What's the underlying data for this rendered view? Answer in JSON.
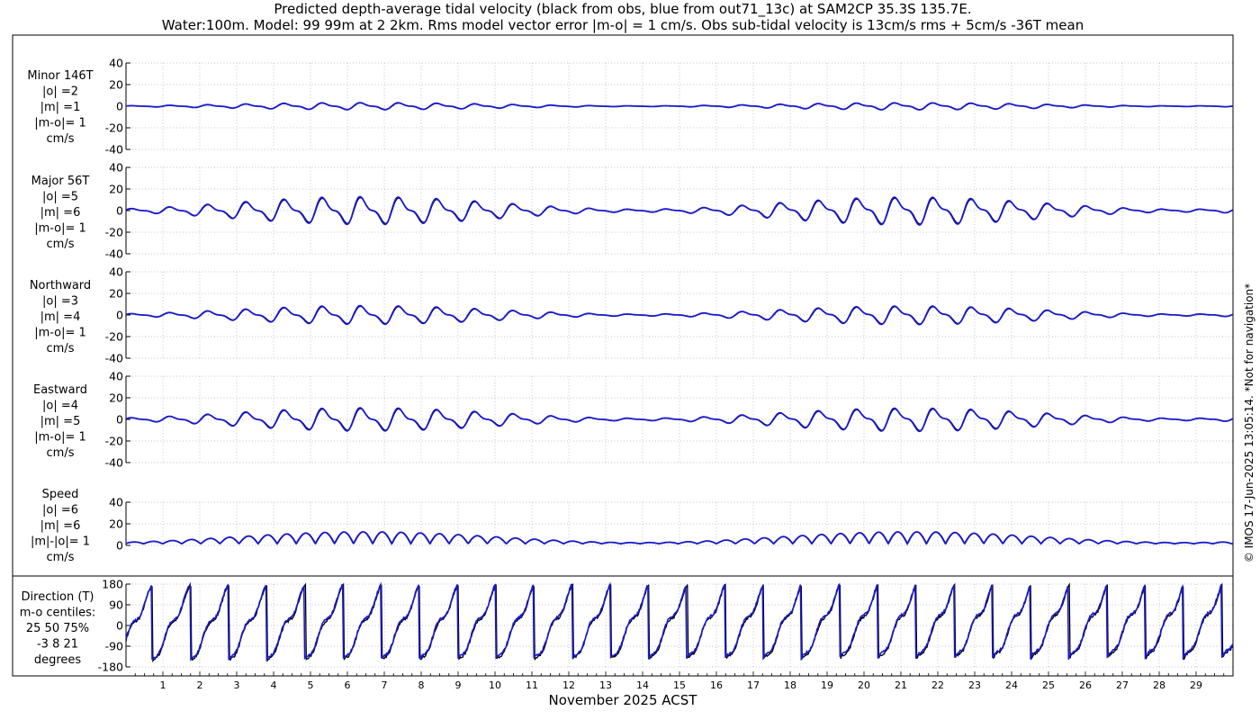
{
  "chart_data": {
    "type": "line",
    "title_line1": "Predicted depth-average tidal velocity (black from obs, blue from out71_13c) at SAM2CP 35.3S 135.7E.",
    "title_line2": "Water:100m. Model: 99 99m at 2 2km. Rms model vector error |m-o| = 1 cm/s. Obs sub-tidal velocity is 13cm/s rms + 5cm/s -36T mean",
    "xlabel": "November 2025 ACST",
    "x_tick_labels": [
      "1",
      "2",
      "3",
      "4",
      "5",
      "6",
      "7",
      "8",
      "9",
      "10",
      "11",
      "12",
      "13",
      "14",
      "15",
      "16",
      "17",
      "18",
      "19",
      "20",
      "21",
      "22",
      "23",
      "24",
      "25",
      "26",
      "27",
      "28",
      "29"
    ],
    "x_range_days": [
      0,
      30
    ],
    "copyright": "© IMOS 17-Jun-2025 13:05:14. *Not for navigation*",
    "series_colors": {
      "obs": "#000000",
      "model": "#1a1acc"
    },
    "grid": true,
    "panels": [
      {
        "id": "minor",
        "label_lines": [
          "Minor 146T",
          "|o| =2",
          "|m| =1",
          "|m-o|= 1",
          "cm/s"
        ],
        "ylim": [
          -40,
          40
        ],
        "yticks": [
          -40,
          -20,
          0,
          20,
          40
        ],
        "amplitude_cm_s": 3
      },
      {
        "id": "major",
        "label_lines": [
          "Major 56T",
          "|o| =5",
          "|m| =6",
          "|m-o|= 1",
          "cm/s"
        ],
        "ylim": [
          -40,
          40
        ],
        "yticks": [
          -40,
          -20,
          0,
          20,
          40
        ],
        "amplitude_cm_s": 12
      },
      {
        "id": "northward",
        "label_lines": [
          "Northward",
          "|o| =3",
          "|m| =4",
          "|m-o|= 1",
          "cm/s"
        ],
        "ylim": [
          -40,
          40
        ],
        "yticks": [
          -40,
          -20,
          0,
          20,
          40
        ],
        "amplitude_cm_s": 8
      },
      {
        "id": "eastward",
        "label_lines": [
          "Eastward",
          "|o| =4",
          "|m| =5",
          "|m-o|= 1",
          "cm/s"
        ],
        "ylim": [
          -40,
          40
        ],
        "yticks": [
          -40,
          -20,
          0,
          20,
          40
        ],
        "amplitude_cm_s": 10
      },
      {
        "id": "speed",
        "label_lines": [
          "Speed",
          "|o| =6",
          "|m| =6",
          "|m|-|o|= 1",
          "cm/s"
        ],
        "ylim": [
          0,
          40
        ],
        "yticks": [
          0,
          20,
          40
        ],
        "amplitude_cm_s": 13
      },
      {
        "id": "direction",
        "label_lines": [
          "Direction (T)",
          "m-o centiles:",
          "25  50  75%",
          "-3   8  21",
          "degrees"
        ],
        "ylim": [
          -180,
          180
        ],
        "yticks": [
          -180,
          -90,
          0,
          90,
          180
        ]
      }
    ]
  }
}
